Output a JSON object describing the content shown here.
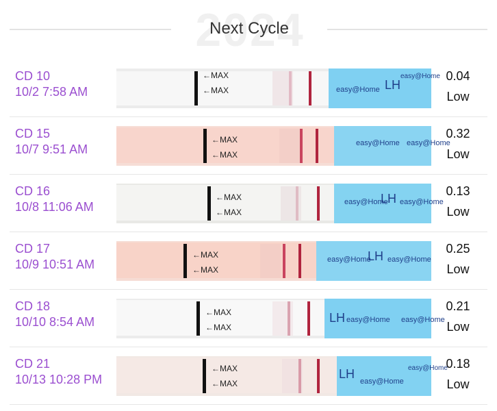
{
  "header": {
    "title": "Next Cycle",
    "watermark": "2024"
  },
  "brand": {
    "name": "easy@Home",
    "marker": "LH",
    "arrow_label": "←MAX"
  },
  "colors": {
    "accent": "#9b4fd0",
    "strip_blue": "#7fd0f2",
    "test_line": "#b0243e"
  },
  "rows": [
    {
      "cd": "CD 10",
      "datetime": "10/2 7:58 AM",
      "value": "0.04",
      "level": "Low"
    },
    {
      "cd": "CD 15",
      "datetime": "10/7 9:51 AM",
      "value": "0.32",
      "level": "Low"
    },
    {
      "cd": "CD 16",
      "datetime": "10/8 11:06 AM",
      "value": "0.13",
      "level": "Low"
    },
    {
      "cd": "CD 17",
      "datetime": "10/9 10:51 AM",
      "value": "0.25",
      "level": "Low"
    },
    {
      "cd": "CD 18",
      "datetime": "10/10 8:54 AM",
      "value": "0.21",
      "level": "Low"
    },
    {
      "cd": "CD 21",
      "datetime": "10/13 10:28 PM",
      "value": "0.18",
      "level": "Low"
    }
  ]
}
